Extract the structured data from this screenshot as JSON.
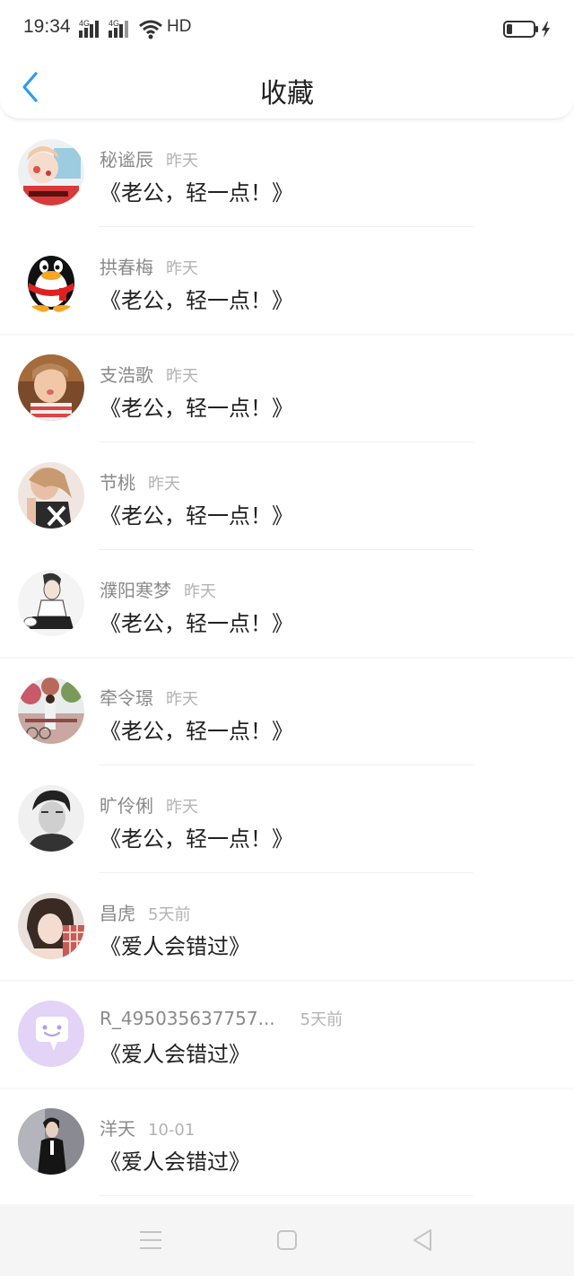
{
  "status_bar": {
    "time": "19:34",
    "network_label": "HD",
    "signal_icons": [
      "4g-signal-icon",
      "4g-signal-icon",
      "wifi-icon"
    ],
    "battery_icon": "battery-charging-icon"
  },
  "header": {
    "title": "收藏",
    "back_icon": "chevron-left-icon"
  },
  "favorites": [
    {
      "name": "秘谧辰",
      "time": "昨天",
      "title": "《老公，轻一点！》"
    },
    {
      "name": "拱春梅",
      "time": "昨天",
      "title": "《老公，轻一点！》"
    },
    {
      "name": "支浩歌",
      "time": "昨天",
      "title": "《老公，轻一点！》"
    },
    {
      "name": "节桃",
      "time": "昨天",
      "title": "《老公，轻一点！》"
    },
    {
      "name": "濮阳寒梦",
      "time": "昨天",
      "title": "《老公，轻一点！》"
    },
    {
      "name": "牵令璟",
      "time": "昨天",
      "title": "《老公，轻一点！》"
    },
    {
      "name": "旷伶俐",
      "time": "昨天",
      "title": "《老公，轻一点！》"
    },
    {
      "name": "昌虎",
      "time": "5天前",
      "title": "《爱人会错过》"
    },
    {
      "name": "R_495035637757...",
      "time": "5天前",
      "title": "《爱人会错过》"
    },
    {
      "name": "洋天",
      "time": "10-01",
      "title": "《爱人会错过》"
    }
  ],
  "nav_bar": {
    "buttons": [
      "menu-icon",
      "home-square-icon",
      "back-triangle-icon"
    ]
  },
  "colors": {
    "accent": "#2f9bf0",
    "name_gray": "#8a8a8a",
    "time_gray": "#b3b3b3",
    "nav_bg": "#f5f5f5"
  }
}
